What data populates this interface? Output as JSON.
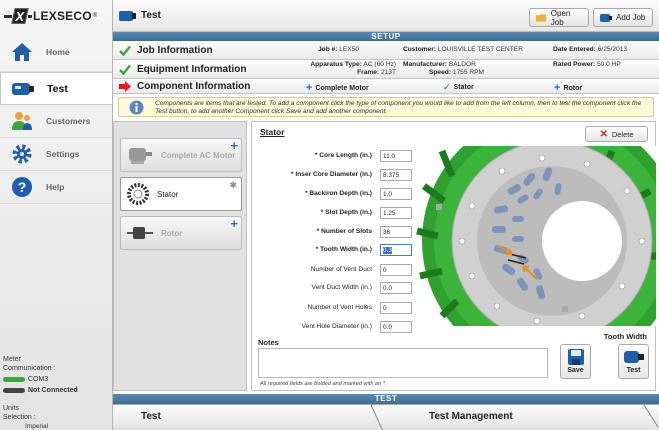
{
  "app": {
    "brand": "LEXSECO",
    "brand_mark": "X"
  },
  "sidebar": {
    "items": [
      {
        "label": "Home",
        "icon": "house-icon"
      },
      {
        "label": "Test",
        "icon": "test-meter-icon"
      },
      {
        "label": "Customers",
        "icon": "customers-icon"
      },
      {
        "label": "Settings",
        "icon": "gear-icon"
      },
      {
        "label": "Help",
        "icon": "help-icon"
      }
    ],
    "meter_label": "Meter",
    "comm_label": "Communication :",
    "port": "COM3",
    "status": "Not Connected",
    "units_label": "Units",
    "selection_label": "Selection :",
    "units_value": "Imperial"
  },
  "header": {
    "title": "Test",
    "open_job": "Open Job",
    "add_job": "Add Job"
  },
  "setup": {
    "title": "SETUP"
  },
  "job": {
    "label": "Job Information",
    "job_key": "Job #:",
    "job_val": "LEX50",
    "customer_key": "Customer:",
    "customer_val": "LOUISVILLE TEST CENTER",
    "date_key": "Date Entered:",
    "date_val": "6/25/2013"
  },
  "equipment": {
    "label": "Equipment Information",
    "apparatus_key": "Apparatus Type:",
    "apparatus_val": "AC (60 Hz)",
    "frame_key": "Frame:",
    "frame_val": "213T",
    "mfr_key": "Manufacturer:",
    "mfr_val": "BALDOR",
    "speed_key": "Speed:",
    "speed_val": "1755 RPM",
    "power_key": "Rated Power:",
    "power_val": "50.0 HP"
  },
  "component": {
    "label": "Component Information",
    "add_motor": "Complete Motor",
    "add_stator": "Stator",
    "add_rotor": "Rotor"
  },
  "note": "Components are items that are tested. To add a component click the type of component you would like to add from the left column, then to test the component click the Test button, to add another Component click Save and add another component.",
  "components": [
    {
      "label": "Complete AC Motor"
    },
    {
      "label": "Stator"
    },
    {
      "label": "Rotor"
    }
  ],
  "stator": {
    "title": "Stator",
    "delete": "Delete",
    "fields": [
      {
        "label": "* Core Length (in.)",
        "value": "11.0",
        "bold": true
      },
      {
        "label": "* Inser Core Diameter (in.)",
        "value": "8.375",
        "bold": true
      },
      {
        "label": "* Backiron Depth (in.)",
        "value": "1.0",
        "bold": true
      },
      {
        "label": "* Slot Depth (in.)",
        "value": "1.25",
        "bold": true
      },
      {
        "label": "* Number of Slots",
        "value": "36",
        "bold": true
      },
      {
        "label": "* Tooth Width (in.)",
        "value": "0.3",
        "bold": true
      },
      {
        "label": "Number of Vent Duct",
        "value": "0",
        "bold": false
      },
      {
        "label": "Vent Duct Width (in.)",
        "value": "0.0",
        "bold": false
      },
      {
        "label": "Number of Vent Holes",
        "value": "0",
        "bold": false
      },
      {
        "label": "Vent Hole Diameter (in.)",
        "value": "0.0",
        "bold": false
      }
    ],
    "notes_label": "Notes",
    "required_note": "All required fields are bolded and marked with an *.",
    "caption": "Tooth Width",
    "save": "Save",
    "test": "Test"
  },
  "test_bar": "TEST",
  "bottom_tabs": {
    "test": "Test",
    "management": "Test Management"
  },
  "colors": {
    "accent_blue": "#3c6c94",
    "check_green": "#3aa53a",
    "arrow_red": "#e01b1b",
    "stator_green": "#2ea12e"
  }
}
